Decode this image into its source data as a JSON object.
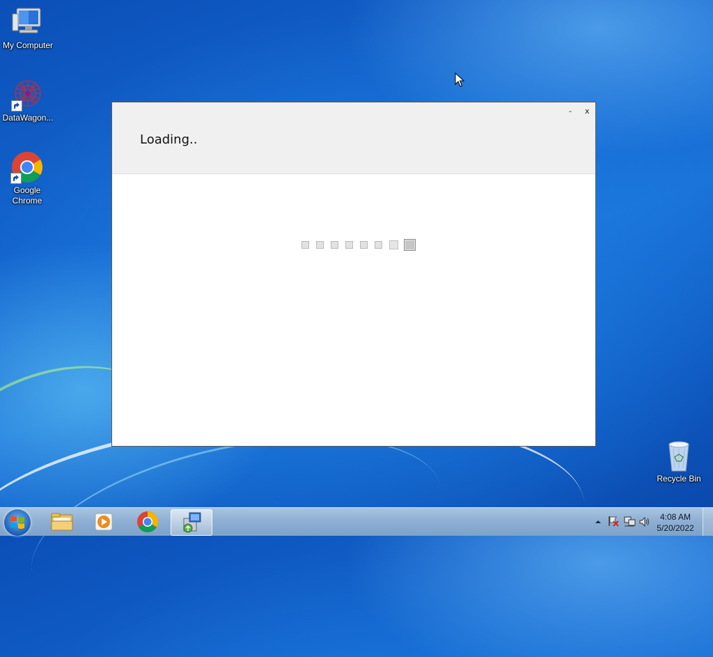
{
  "desktop": {
    "icons": [
      {
        "label": "My Computer",
        "icon": "computer-icon"
      },
      {
        "label": "DataWagon...",
        "icon": "datawagon-icon"
      },
      {
        "label": "Google Chrome",
        "icon": "chrome-icon"
      },
      {
        "label": "Recycle Bin",
        "icon": "recycle-bin-icon"
      }
    ]
  },
  "dialog": {
    "title": "Loading..",
    "minimize_label": "-",
    "close_label": "x",
    "progress_dots": 8
  },
  "taskbar": {
    "pinned": [
      "file-explorer-icon",
      "media-player-icon",
      "chrome-icon",
      "installer-icon"
    ],
    "tray": {
      "time": "4:08 AM",
      "date": "5/20/2022"
    }
  }
}
